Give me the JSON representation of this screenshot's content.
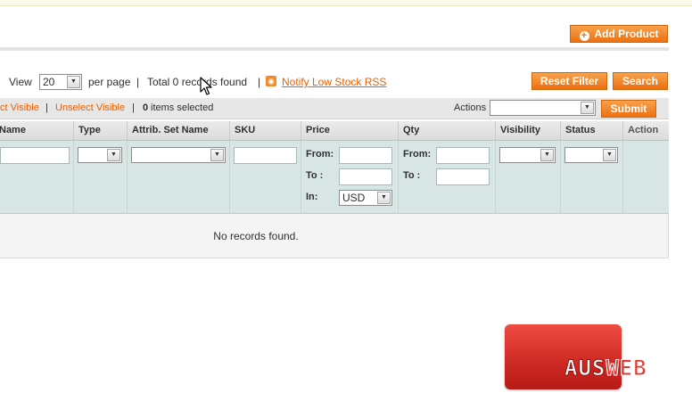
{
  "header": {
    "add_product_label": "Add Product"
  },
  "pager": {
    "view_label": "View",
    "per_page_value": "20",
    "per_page_label": "per page",
    "separator": "|",
    "records_found": "Total 0 records found",
    "rss_link": "Notify Low Stock RSS"
  },
  "buttons": {
    "reset_filter": "Reset Filter",
    "search": "Search",
    "submit": "Submit"
  },
  "massaction": {
    "select_visible": "ct Visible",
    "separator": "|",
    "unselect_visible": "Unselect Visible",
    "selected_count": "0",
    "items_selected_label": "items selected",
    "actions_label": "Actions",
    "actions_value": ""
  },
  "columns": [
    {
      "label": "Name"
    },
    {
      "label": "Type"
    },
    {
      "label": "Attrib. Set Name"
    },
    {
      "label": "SKU"
    },
    {
      "label": "Price"
    },
    {
      "label": "Qty"
    },
    {
      "label": "Visibility"
    },
    {
      "label": "Status"
    },
    {
      "label": "Action"
    }
  ],
  "filters": {
    "from_label": "From:",
    "to_label": "To :",
    "in_label": "In:",
    "currency_value": "USD"
  },
  "grid": {
    "empty_message": "No records found."
  },
  "logo": {
    "text_left": "AUS",
    "text_right": "WEB"
  },
  "colors": {
    "accent_orange": "#ec7012",
    "link_orange": "#eb5e00",
    "filter_bg": "#d7e5e4",
    "logo_red": "#d83028"
  }
}
